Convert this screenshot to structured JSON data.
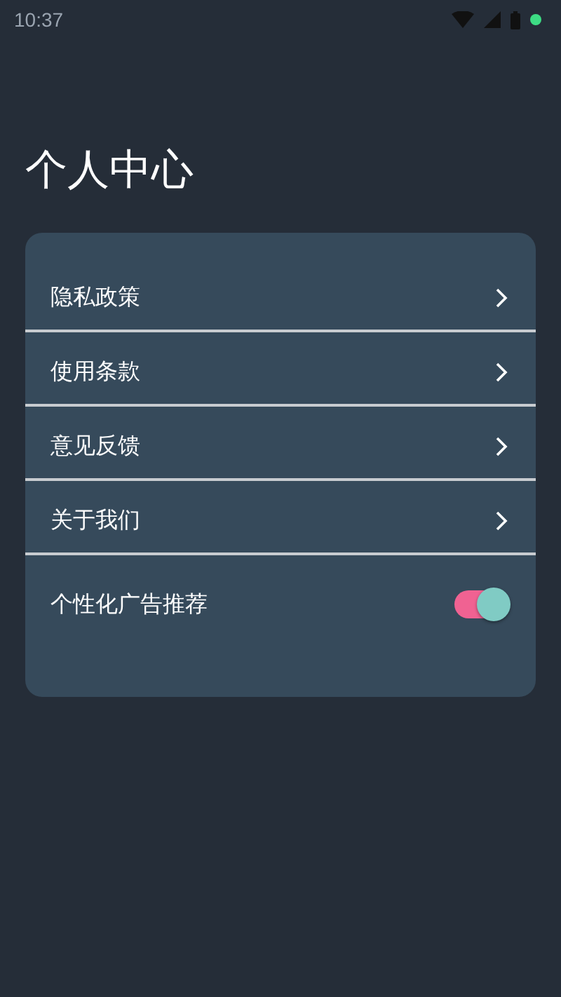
{
  "status_bar": {
    "time": "10:37"
  },
  "title": "个人中心",
  "items": [
    {
      "kind": "link",
      "label": "隐私政策"
    },
    {
      "kind": "link",
      "label": "使用条款"
    },
    {
      "kind": "link",
      "label": "意见反馈"
    },
    {
      "kind": "link",
      "label": "关于我们"
    },
    {
      "kind": "toggle",
      "label": "个性化广告推荐",
      "on": true
    }
  ]
}
